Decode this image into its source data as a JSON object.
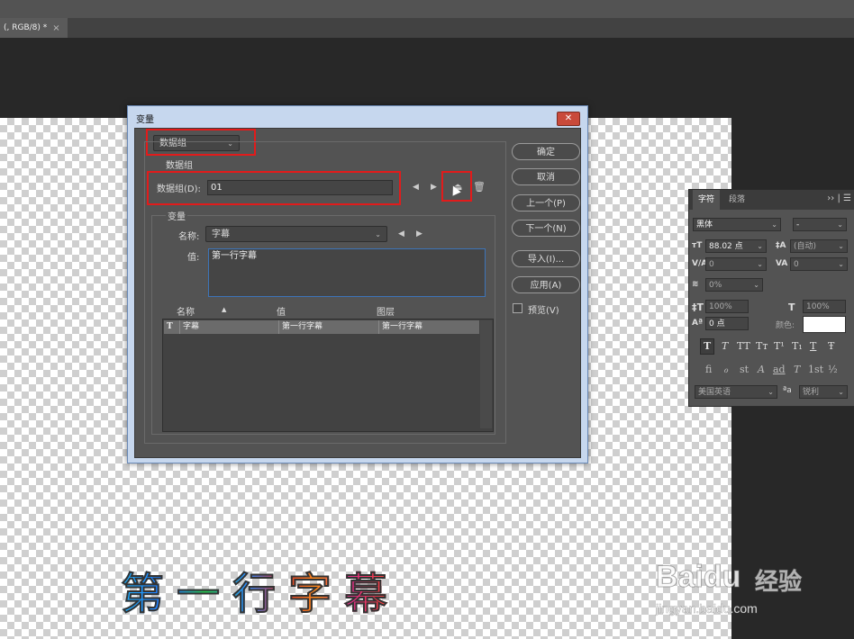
{
  "document": {
    "tab_title": "(, RGB/8) *",
    "close_glyph": "×"
  },
  "canvas": {
    "caption": "第一行字幕"
  },
  "watermark": {
    "brand": "Baidu",
    "brand_cn": "经验",
    "url": "jingyan.baidu.com"
  },
  "dialog": {
    "title": "变量",
    "close_glyph": "✕",
    "mode_select": "数据组",
    "dataset_group_label": "数据组",
    "dataset_label": "数据组(D):",
    "dataset_value": "01",
    "variable_group_label": "变量",
    "name_label": "名称:",
    "name_value": "字幕",
    "value_label": "值:",
    "value_text": "第一行字幕",
    "table_headers": {
      "name": "名称",
      "value": "值",
      "layer": "图层"
    },
    "table_rows": [
      {
        "type_icon": "T",
        "name": "字幕",
        "value": "第一行字幕",
        "layer": "第一行字幕"
      }
    ],
    "buttons": {
      "ok": "确定",
      "cancel": "取消",
      "prev": "上一个(P)",
      "next": "下一个(N)",
      "import": "导入(I)...",
      "apply": "应用(A)"
    },
    "preview_label": "预览(V)"
  },
  "character_panel": {
    "tabs": [
      "字符",
      "段落"
    ],
    "font_family": "黑体",
    "font_style": "-",
    "font_size": "88.02 点",
    "leading": "(自动)",
    "kerning": "0",
    "tracking": "0",
    "scale_pct": "0%",
    "vertical_scale": "100%",
    "horizontal_scale": "100%",
    "baseline_shift": "0 点",
    "color_label": "颜色:",
    "language": "美国英语",
    "aa_icon": "ªa",
    "anti_alias": "锐利",
    "style_buttons": [
      "T",
      "T",
      "TT",
      "Tт",
      "T¹",
      "T₁",
      "T",
      "Ŧ"
    ],
    "opentype_buttons": [
      "fi",
      "ℴ",
      "st",
      "A",
      "ad",
      "T",
      "1st",
      "½"
    ]
  },
  "colors": {
    "highlight": "#e21b1b",
    "dialog_chrome": "#c6d7ee"
  }
}
